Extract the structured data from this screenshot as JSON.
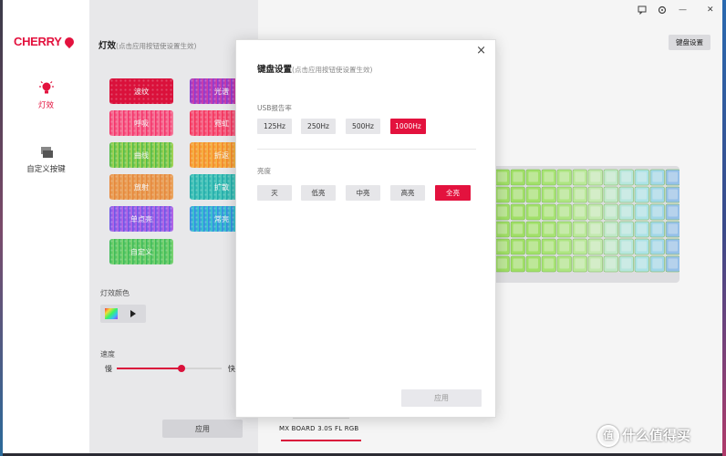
{
  "brand": {
    "name": "CHERRY",
    "accent": "#e3123e"
  },
  "nav": {
    "items": [
      {
        "label": "灯效",
        "icon": "lightbulb-icon",
        "active": true
      },
      {
        "label": "自定义按键",
        "icon": "keys-icon",
        "active": false
      }
    ]
  },
  "window_controls": {
    "feedback": "feedback-icon",
    "settings": "settings-icon",
    "minimize": "—",
    "close": "✕"
  },
  "lighting": {
    "title": "灯效",
    "hint": "(点击应用按钮使设置生效)",
    "effects": [
      {
        "label": "波纹",
        "color": "#e3123e"
      },
      {
        "label": "光谱",
        "color": "purple-pink-gradient"
      },
      {
        "label": "呼吸",
        "color": "red-pink-gradient"
      },
      {
        "label": "霓虹",
        "color": "red-pink-gradient"
      },
      {
        "label": "曲线",
        "color": "green-lime-gradient"
      },
      {
        "label": "折返",
        "color": "orange-yellow-gradient"
      },
      {
        "label": "放射",
        "color": "orange-gradient"
      },
      {
        "label": "扩散",
        "color": "teal-gradient"
      },
      {
        "label": "单点亮",
        "color": "blue-purple-gradient"
      },
      {
        "label": "常亮",
        "color": "blue-teal-gradient"
      },
      {
        "label": "自定义",
        "color": "green-gradient"
      }
    ],
    "color_label": "灯效颜色",
    "speed_label": "速度",
    "speed_slow": "慢",
    "speed_fast": "快",
    "speed_value": 0.62,
    "apply": "应用"
  },
  "main": {
    "keyboard_settings_button": "键盘设置",
    "product_name": "MX BOARD 3.0S FL RGB"
  },
  "dialog": {
    "title": "键盘设置",
    "hint": "(点击应用按钮使设置生效)",
    "close": "×",
    "usb_label": "USB报告率",
    "usb_options": [
      "125Hz",
      "250Hz",
      "500Hz",
      "1000Hz"
    ],
    "usb_selected": "1000Hz",
    "brightness_label": "亮度",
    "brightness_options": [
      "灭",
      "低亮",
      "中亮",
      "高亮",
      "全亮"
    ],
    "brightness_selected": "全亮",
    "apply": "应用"
  },
  "watermark": {
    "symbol": "值",
    "text": "什么值得买"
  }
}
